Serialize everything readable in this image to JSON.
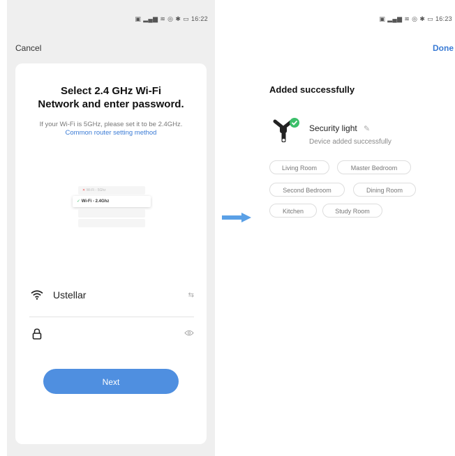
{
  "left_screen": {
    "status_time": "16:22",
    "cancel_label": "Cancel",
    "title_line1": "Select 2.4 GHz Wi-Fi",
    "title_line2": "Network and enter password.",
    "hint_text": "If your Wi-Fi is 5GHz, please set it to be 2.4GHz.",
    "hint_link": "Common router setting method",
    "illustration": {
      "row_top": "Wi-Fi - 5Ghz",
      "row_active": "Wi-Fi - 2.4Ghz"
    },
    "wifi_name": "Ustellar",
    "password_value": "",
    "next_label": "Next"
  },
  "right_screen": {
    "status_time": "16:23",
    "done_label": "Done",
    "title": "Added successfully",
    "device_name": "Security light",
    "device_status": "Device added successfully",
    "rooms": [
      "Living Room",
      "Master Bedroom",
      "Second Bedroom",
      "Dining Room",
      "Kitchen",
      "Study Room"
    ]
  },
  "colors": {
    "accent": "#3a7bd5",
    "button": "#4f8fe0",
    "success": "#3cbf6a",
    "arrow": "#5aa0e6"
  },
  "icons": [
    "wifi-icon",
    "lock-icon",
    "swap-icon",
    "eye-icon",
    "edit-icon",
    "check-icon",
    "arrow-right-icon"
  ]
}
